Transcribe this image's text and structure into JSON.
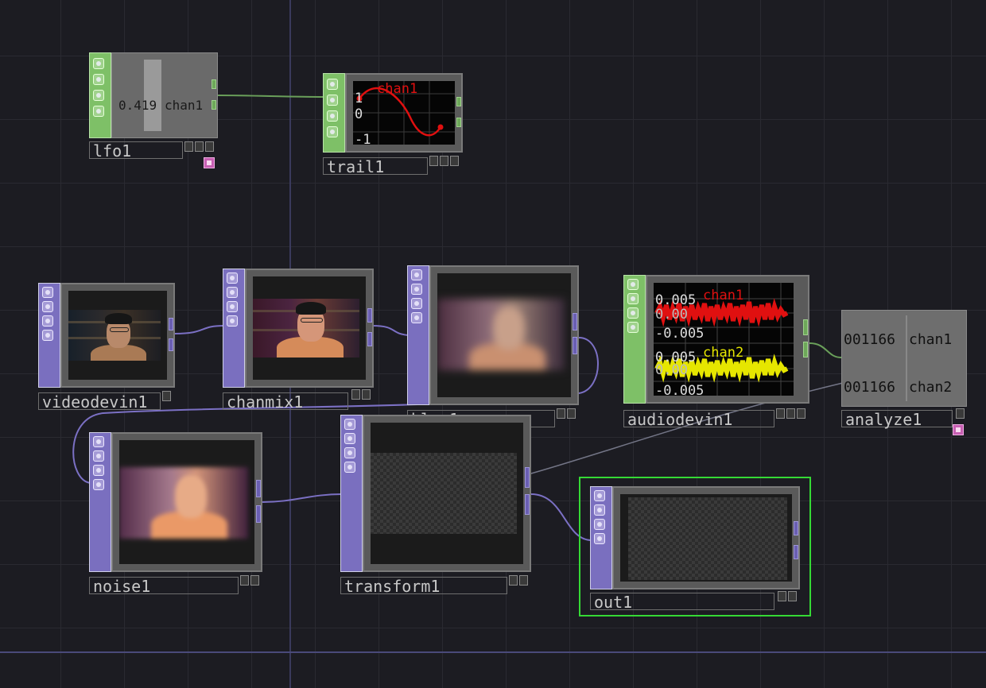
{
  "canvas": {
    "background": "#1c1c22",
    "grid_color": "#2a2a31"
  },
  "colors": {
    "top_family": "#7a6fbf",
    "chop_family": "#7ec067",
    "wire_top": "#7b70c4",
    "wire_chop": "#6aa05a",
    "active_border": "#35d935",
    "chan1": "#e01010",
    "chan2": "#e6e600"
  },
  "nodes": {
    "lfo1": {
      "name": "lfo1",
      "value": "0.419",
      "channel": "chan1"
    },
    "trail1": {
      "name": "trail1",
      "channel": "chan1",
      "tick_top": "1",
      "tick_mid": "0",
      "tick_bottom": "-1"
    },
    "videodevin1": {
      "name": "videodevin1"
    },
    "chanmix1": {
      "name": "chanmix1"
    },
    "blur1": {
      "name": "blur1"
    },
    "audiodevin1": {
      "name": "audiodevin1",
      "chan1_label": "chan1",
      "chan1_top": "0.005",
      "chan1_mid": "0.00",
      "chan1_bottom": "-0.005",
      "chan2_label": "chan2",
      "chan2_top": "0.005",
      "chan2_mid": "0.00",
      "chan2_bottom": "-0.005"
    },
    "analyze1": {
      "name": "analyze1",
      "row1_value": "001166",
      "row1_channel": "chan1",
      "row2_value": "001166",
      "row2_channel": "chan2"
    },
    "noise1": {
      "name": "noise1"
    },
    "transform1": {
      "name": "transform1"
    },
    "out1": {
      "name": "out1",
      "active": true
    }
  },
  "icons": {
    "strip_buttons": [
      "viewer-toggle-icon",
      "bypass-icon",
      "lock-icon",
      "cook-icon"
    ],
    "node_flags": [
      "display-flag-icon",
      "render-flag-icon",
      "lock-flag-icon"
    ],
    "extra": "cook-indicator-icon"
  }
}
